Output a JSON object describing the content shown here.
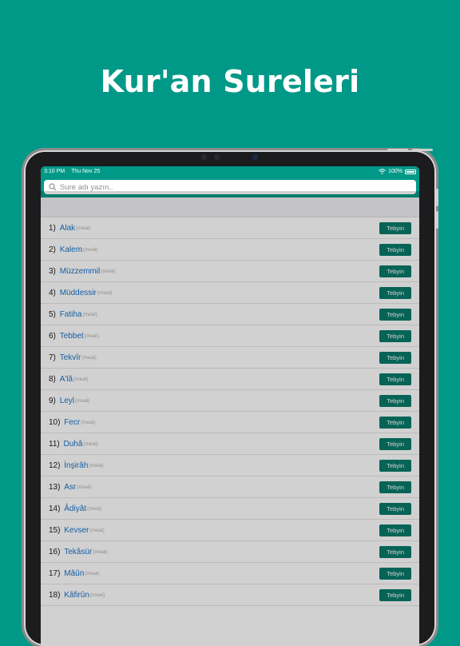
{
  "headline": "Kur'an Sureleri",
  "status": {
    "time": "3:10 PM",
    "date": "Thu Nov 25",
    "battery": "100%"
  },
  "search": {
    "placeholder": "Sure adı yazın.."
  },
  "rows": [
    {
      "num": "1)",
      "name": "Alak",
      "meal": "(meal)",
      "button": "Tebyin"
    },
    {
      "num": "2)",
      "name": "Kalem",
      "meal": "(meal)",
      "button": "Tebyin"
    },
    {
      "num": "3)",
      "name": "Müzzemmil",
      "meal": "(meal)",
      "button": "Tebyin"
    },
    {
      "num": "4)",
      "name": "Müddessir",
      "meal": "(meal)",
      "button": "Tebyin"
    },
    {
      "num": "5)",
      "name": "Fatiha",
      "meal": "(meal)",
      "button": "Tebyin"
    },
    {
      "num": "6)",
      "name": "Tebbet",
      "meal": "(meal)",
      "button": "Tebyin"
    },
    {
      "num": "7)",
      "name": "Tekvîr",
      "meal": "(meal)",
      "button": "Tebyin"
    },
    {
      "num": "8)",
      "name": "A'lâ",
      "meal": "(meal)",
      "button": "Tebyin"
    },
    {
      "num": "9)",
      "name": "Leyl",
      "meal": "(meal)",
      "button": "Tebyin"
    },
    {
      "num": "10)",
      "name": "Fecr",
      "meal": "(meal)",
      "button": "Tebyin"
    },
    {
      "num": "11)",
      "name": "Duhâ",
      "meal": "(meal)",
      "button": "Tebyin"
    },
    {
      "num": "12)",
      "name": "İnşirâh",
      "meal": "(meal)",
      "button": "Tebyin"
    },
    {
      "num": "13)",
      "name": "Asr",
      "meal": "(meal)",
      "button": "Tebyin"
    },
    {
      "num": "14)",
      "name": "Âdiyât",
      "meal": "(meal)",
      "button": "Tebyin"
    },
    {
      "num": "15)",
      "name": "Kevser",
      "meal": "(meal)",
      "button": "Tebyin"
    },
    {
      "num": "16)",
      "name": "Tekâsür",
      "meal": "(meal)",
      "button": "Tebyin"
    },
    {
      "num": "17)",
      "name": "Mâûn",
      "meal": "(meal)",
      "button": "Tebyin"
    },
    {
      "num": "18)",
      "name": "Kâfirûn",
      "meal": "(meal)",
      "button": "Tebyin"
    }
  ],
  "colors": {
    "brand": "#009987",
    "button": "#087a6a",
    "link": "#1a73c8"
  }
}
